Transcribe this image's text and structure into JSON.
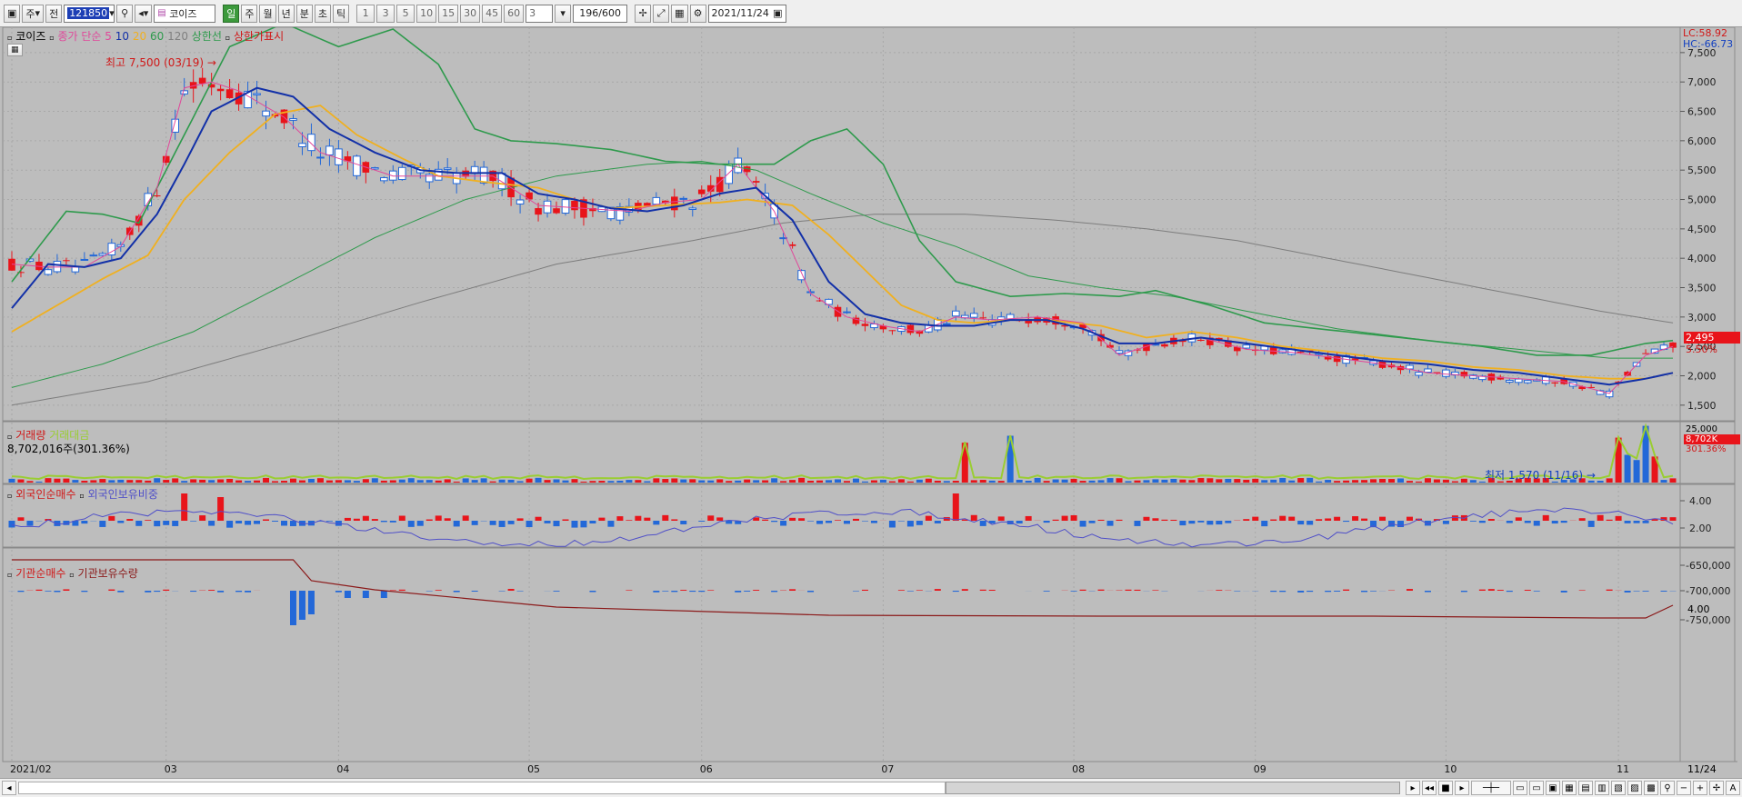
{
  "toolbar": {
    "period_day": "일",
    "period_week": "주",
    "period_month": "월",
    "period_year": "년",
    "period_min": "분",
    "period_sec": "초",
    "period_tick": "틱",
    "period_label": "주",
    "chart_mode": "전",
    "stock_code": "121850",
    "stock_name": "코이즈",
    "intervals": [
      "1",
      "3",
      "5",
      "10",
      "15",
      "30",
      "45",
      "60"
    ],
    "interval_value": "3",
    "view_count": "196",
    "view_total": "/600",
    "date": "2021/11/24"
  },
  "price_panel": {
    "stock_label": "코이즈",
    "ma_title": "종가 단순",
    "ma_periods": [
      {
        "label": "5",
        "color": "#e0489a"
      },
      {
        "label": "10",
        "color": "#1230a8"
      },
      {
        "label": "20",
        "color": "#f0b020"
      },
      {
        "label": "60",
        "color": "#2e9a4c"
      },
      {
        "label": "120",
        "color": "#808080"
      }
    ],
    "upper_limit_label": "상한선",
    "upper_limit_show_label": "상한가표시",
    "lc": "LC:58.92",
    "hc": "HC:-66.73",
    "current_price": "2,495",
    "current_pct": "5.50%",
    "high_note": "최고 7,500 (03/19)",
    "low_note": "최저 1,570 (11/16)",
    "y_ticks": [
      "7,500",
      "7,000",
      "6,500",
      "6,000",
      "5,500",
      "5,000",
      "4,500",
      "4,000",
      "3,500",
      "3,000",
      "2,500",
      "2,000",
      "1,500"
    ]
  },
  "volume_panel": {
    "title": "거래량",
    "title2": "거래대금",
    "value_text": "8,702,016주(301.36%)",
    "y_tick": "25,000",
    "current": "8,702K",
    "current_pct": "301.36%"
  },
  "foreign_panel": {
    "title": "외국인순매수",
    "title2": "외국인보유비중",
    "y_ticks": [
      "4.00",
      "2.00"
    ]
  },
  "inst_panel": {
    "title": "기관순매수",
    "title2": "기관보유수량",
    "y_ticks": [
      "-650,000",
      "-700,000",
      "-750,000"
    ]
  },
  "x_axis": {
    "labels": [
      "2021/02",
      "03",
      "04",
      "05",
      "06",
      "07",
      "08",
      "09",
      "10",
      "11"
    ],
    "end_label": "11/24"
  },
  "colors": {
    "up": "#e8141a",
    "down": "#2368d8",
    "bg": "#bdbdbd",
    "grid": "#a8a8a8"
  },
  "chart_data": {
    "type": "candlestick",
    "ylim": [
      1250,
      7900
    ],
    "ma_key_points": {
      "5": [
        [
          0,
          3900
        ],
        [
          4,
          3850
        ],
        [
          8,
          3850
        ],
        [
          12,
          4200
        ],
        [
          16,
          5200
        ],
        [
          19,
          6900
        ],
        [
          22,
          7000
        ],
        [
          25,
          6850
        ],
        [
          30,
          6400
        ],
        [
          34,
          5800
        ],
        [
          38,
          5600
        ],
        [
          42,
          5400
        ],
        [
          47,
          5400
        ],
        [
          53,
          5400
        ],
        [
          58,
          4900
        ],
        [
          63,
          4850
        ],
        [
          68,
          4800
        ],
        [
          72,
          4950
        ],
        [
          76,
          5000
        ],
        [
          80,
          5600
        ],
        [
          84,
          4800
        ],
        [
          88,
          3400
        ],
        [
          92,
          3000
        ],
        [
          96,
          2850
        ],
        [
          100,
          2750
        ],
        [
          104,
          3000
        ],
        [
          108,
          2950
        ],
        [
          113,
          3000
        ],
        [
          118,
          2900
        ],
        [
          122,
          2350
        ],
        [
          126,
          2550
        ],
        [
          131,
          2650
        ],
        [
          136,
          2450
        ],
        [
          141,
          2400
        ],
        [
          146,
          2300
        ],
        [
          151,
          2200
        ],
        [
          156,
          2050
        ],
        [
          161,
          2000
        ],
        [
          166,
          1950
        ],
        [
          171,
          1900
        ],
        [
          176,
          1700
        ],
        [
          180,
          2350
        ],
        [
          183,
          2500
        ]
      ],
      "10": [
        [
          0,
          3150
        ],
        [
          4,
          3900
        ],
        [
          8,
          3850
        ],
        [
          12,
          4000
        ],
        [
          16,
          4750
        ],
        [
          19,
          5600
        ],
        [
          22,
          6500
        ],
        [
          27,
          6900
        ],
        [
          31,
          6750
        ],
        [
          35,
          6200
        ],
        [
          40,
          5800
        ],
        [
          45,
          5500
        ],
        [
          49,
          5450
        ],
        [
          54,
          5450
        ],
        [
          58,
          5100
        ],
        [
          62,
          5000
        ],
        [
          66,
          4850
        ],
        [
          70,
          4800
        ],
        [
          74,
          4900
        ],
        [
          78,
          5100
        ],
        [
          82,
          5200
        ],
        [
          86,
          4650
        ],
        [
          90,
          3600
        ],
        [
          94,
          3050
        ],
        [
          98,
          2900
        ],
        [
          102,
          2850
        ],
        [
          106,
          2850
        ],
        [
          110,
          2950
        ],
        [
          114,
          2950
        ],
        [
          118,
          2800
        ],
        [
          122,
          2550
        ],
        [
          126,
          2550
        ],
        [
          131,
          2650
        ],
        [
          136,
          2550
        ],
        [
          141,
          2450
        ],
        [
          146,
          2350
        ],
        [
          151,
          2250
        ],
        [
          156,
          2200
        ],
        [
          161,
          2100
        ],
        [
          166,
          2050
        ],
        [
          171,
          1950
        ],
        [
          176,
          1850
        ],
        [
          180,
          1950
        ],
        [
          183,
          2050
        ]
      ],
      "20": [
        [
          0,
          2750
        ],
        [
          5,
          3200
        ],
        [
          10,
          3650
        ],
        [
          15,
          4050
        ],
        [
          19,
          5000
        ],
        [
          24,
          5800
        ],
        [
          29,
          6450
        ],
        [
          34,
          6600
        ],
        [
          38,
          6100
        ],
        [
          43,
          5700
        ],
        [
          47,
          5400
        ],
        [
          52,
          5300
        ],
        [
          58,
          5200
        ],
        [
          62,
          5000
        ],
        [
          66,
          4850
        ],
        [
          72,
          4900
        ],
        [
          78,
          4950
        ],
        [
          81,
          5000
        ],
        [
          86,
          4900
        ],
        [
          90,
          4400
        ],
        [
          94,
          3800
        ],
        [
          98,
          3200
        ],
        [
          102,
          2950
        ],
        [
          106,
          2900
        ],
        [
          110,
          2950
        ],
        [
          114,
          2950
        ],
        [
          120,
          2850
        ],
        [
          125,
          2650
        ],
        [
          130,
          2750
        ],
        [
          135,
          2650
        ],
        [
          140,
          2500
        ],
        [
          146,
          2400
        ],
        [
          151,
          2300
        ],
        [
          156,
          2250
        ],
        [
          161,
          2150
        ],
        [
          166,
          2100
        ],
        [
          171,
          2000
        ],
        [
          176,
          1950
        ],
        [
          180,
          1950
        ],
        [
          183,
          2050
        ]
      ],
      "60": [
        [
          0,
          1800
        ],
        [
          10,
          2200
        ],
        [
          20,
          2750
        ],
        [
          30,
          3550
        ],
        [
          40,
          4350
        ],
        [
          50,
          5000
        ],
        [
          60,
          5400
        ],
        [
          70,
          5600
        ],
        [
          76,
          5650
        ],
        [
          82,
          5500
        ],
        [
          88,
          5100
        ],
        [
          96,
          4600
        ],
        [
          104,
          4200
        ],
        [
          112,
          3700
        ],
        [
          120,
          3500
        ],
        [
          128,
          3350
        ],
        [
          136,
          3100
        ],
        [
          146,
          2800
        ],
        [
          156,
          2600
        ],
        [
          166,
          2450
        ],
        [
          176,
          2300
        ],
        [
          183,
          2300
        ]
      ],
      "120": [
        [
          0,
          1500
        ],
        [
          15,
          1900
        ],
        [
          30,
          2550
        ],
        [
          45,
          3250
        ],
        [
          60,
          3900
        ],
        [
          75,
          4300
        ],
        [
          85,
          4600
        ],
        [
          95,
          4750
        ],
        [
          105,
          4750
        ],
        [
          115,
          4650
        ],
        [
          125,
          4500
        ],
        [
          135,
          4300
        ],
        [
          145,
          4000
        ],
        [
          155,
          3700
        ],
        [
          165,
          3400
        ],
        [
          175,
          3100
        ],
        [
          183,
          2900
        ]
      ],
      "upper_band": [
        [
          0,
          3600
        ],
        [
          6,
          4800
        ],
        [
          10,
          4750
        ],
        [
          14,
          4600
        ],
        [
          18,
          5800
        ],
        [
          24,
          7600
        ],
        [
          30,
          8000
        ],
        [
          36,
          7600
        ],
        [
          42,
          7900
        ],
        [
          47,
          7300
        ],
        [
          51,
          6200
        ],
        [
          55,
          6000
        ],
        [
          60,
          5950
        ],
        [
          66,
          5850
        ],
        [
          72,
          5650
        ],
        [
          78,
          5600
        ],
        [
          84,
          5600
        ],
        [
          88,
          6000
        ],
        [
          92,
          6200
        ],
        [
          96,
          5600
        ],
        [
          100,
          4300
        ],
        [
          104,
          3600
        ],
        [
          110,
          3350
        ],
        [
          116,
          3400
        ],
        [
          122,
          3350
        ],
        [
          126,
          3450
        ],
        [
          132,
          3200
        ],
        [
          138,
          2900
        ],
        [
          144,
          2800
        ],
        [
          150,
          2700
        ],
        [
          156,
          2600
        ],
        [
          162,
          2500
        ],
        [
          168,
          2350
        ],
        [
          174,
          2350
        ],
        [
          180,
          2550
        ],
        [
          183,
          2600
        ]
      ]
    },
    "volume_highlight_idx": [
      105,
      110,
      177,
      178,
      179,
      180,
      181
    ],
    "volume_max": 25000
  }
}
